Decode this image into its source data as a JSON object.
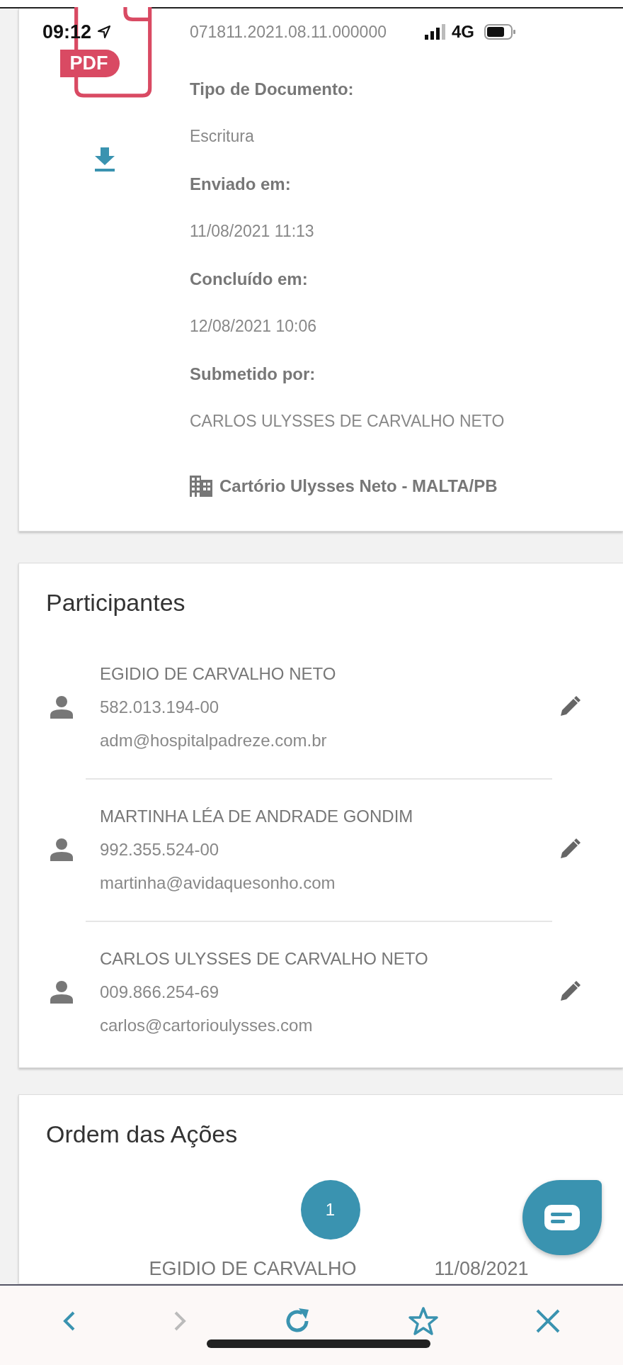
{
  "status_bar": {
    "time": "09:12",
    "network": "4G"
  },
  "document": {
    "badge": "PDF",
    "number": "071811.2021.08.11.000000",
    "fields": [
      {
        "label": "Tipo de Documento:",
        "value": "Escritura"
      },
      {
        "label": "Enviado em:",
        "value": "11/08/2021 11:13"
      },
      {
        "label": "Concluído em:",
        "value": "12/08/2021 10:06"
      },
      {
        "label": "Submetido por:",
        "value": "CARLOS ULYSSES DE CARVALHO NETO"
      }
    ],
    "office": "Cartório Ulysses Neto - MALTA/PB"
  },
  "participants": {
    "title": "Participantes",
    "items": [
      {
        "name": "EGIDIO DE CARVALHO NETO",
        "cpf": "582.013.194-00",
        "email": "adm@hospitalpadreze.com.br"
      },
      {
        "name": "MARTINHA LÉA DE ANDRADE GONDIM",
        "cpf": "992.355.524-00",
        "email": "martinha@avidaquesonho.com"
      },
      {
        "name": "CARLOS ULYSSES DE CARVALHO NETO",
        "cpf": "009.866.254-69",
        "email": "carlos@cartorioulysses.com"
      }
    ]
  },
  "actions": {
    "title": "Ordem das Ações",
    "steps": [
      {
        "number": "1",
        "name": "EGIDIO DE CARVALHO",
        "date": "11/08/2021"
      }
    ]
  },
  "browser_toolbar": [
    {
      "kind": "back",
      "disabled": false
    },
    {
      "kind": "forward",
      "disabled": true
    },
    {
      "kind": "reload",
      "disabled": false
    },
    {
      "kind": "bookmark",
      "disabled": false
    },
    {
      "kind": "close",
      "disabled": false
    }
  ]
}
